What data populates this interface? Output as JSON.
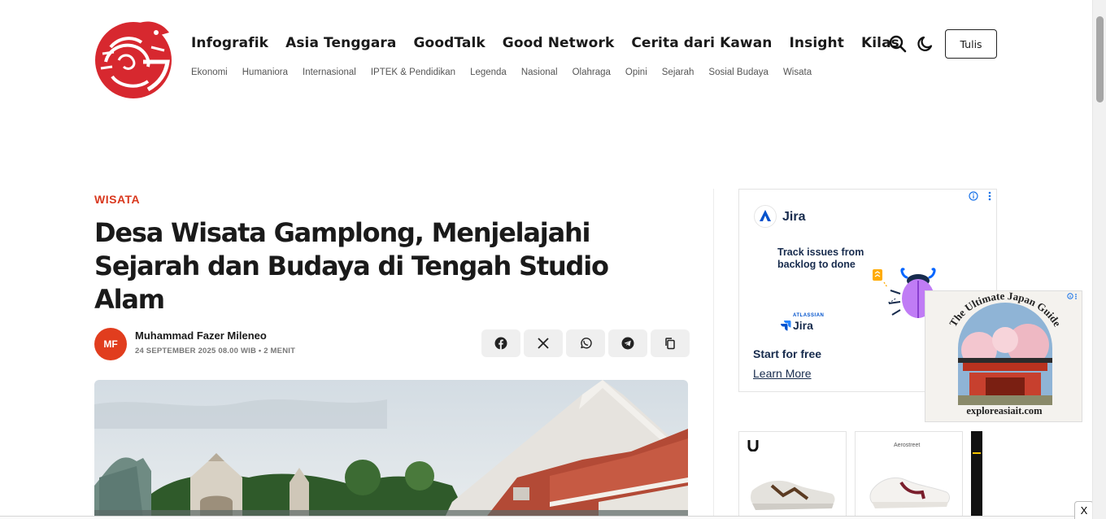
{
  "header": {
    "nav_main": [
      "Infografik",
      "Asia Tenggara",
      "GoodTalk",
      "Good Network",
      "Cerita dari Kawan",
      "Insight",
      "Kilas"
    ],
    "nav_sub": [
      "Ekonomi",
      "Humaniora",
      "Internasional",
      "IPTEK & Pendidikan",
      "Legenda",
      "Nasional",
      "Olahraga",
      "Opini",
      "Sejarah",
      "Sosial Budaya",
      "Wisata"
    ],
    "write_label": "Tulis",
    "icons": [
      "search-icon",
      "dark-mode-icon"
    ],
    "accent_color": "#d9381e"
  },
  "article": {
    "category": "WISATA",
    "title": "Desa Wisata Gamplong, Menjelajahi Sejarah dan Budaya di Tengah Studio Alam",
    "author_initials": "MF",
    "author": "Muhammad Fazer Mileneo",
    "meta": "24 SEPTEMBER 2025 08.00 WIB • 2 MENIT",
    "share_icons": [
      "facebook-icon",
      "x-icon",
      "whatsapp-icon",
      "telegram-icon",
      "copy-link-icon"
    ]
  },
  "ads": {
    "jira": {
      "brand": "Jira",
      "tagline": "Track issues from backlog to done",
      "atlassian": "ATLASSIAN",
      "logo_text": "Jira",
      "cta_heading": "Start for free",
      "cta_link": "Learn More"
    },
    "japan": {
      "headline": "The Ultimate Japan Guide",
      "site": "exploreasiait.com"
    },
    "products": [
      {
        "brand": ""
      },
      {
        "brand": "Aerostreet"
      }
    ],
    "close_label": "X"
  }
}
